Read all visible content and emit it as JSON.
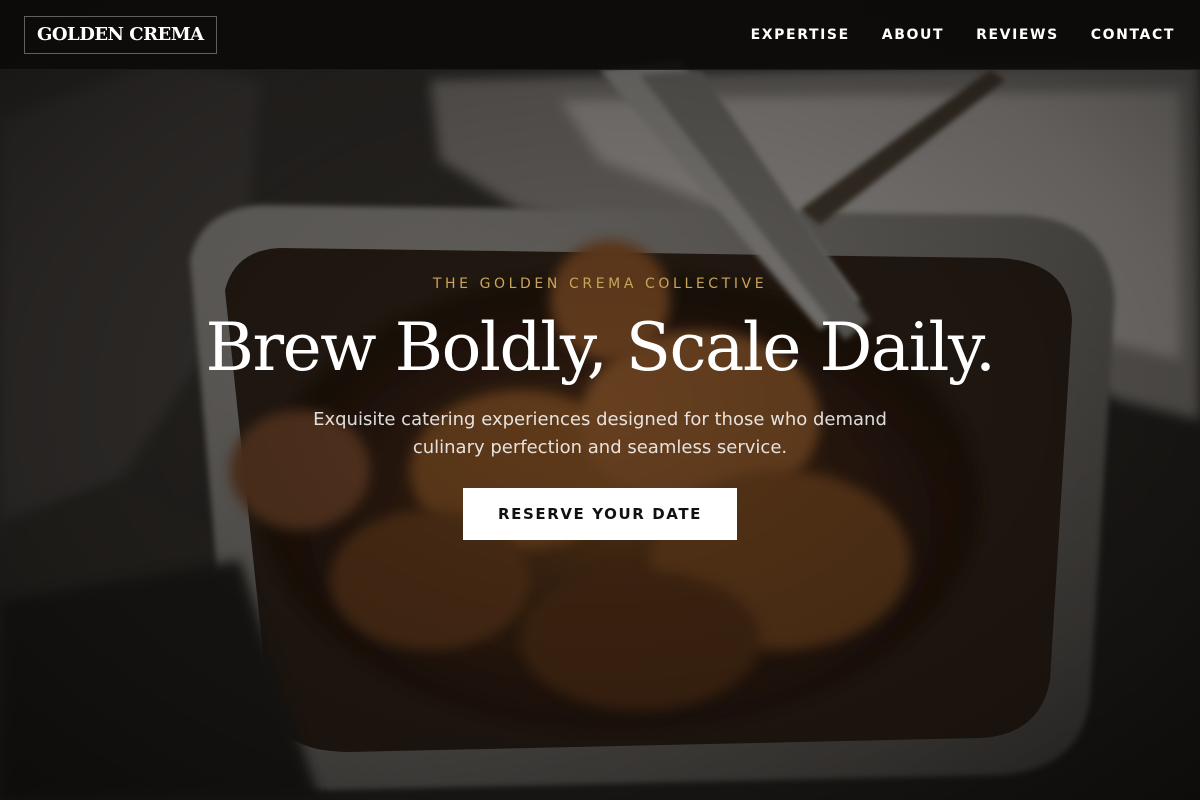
{
  "header": {
    "logo_text": "GOLDEN CREMA",
    "nav": [
      {
        "label": "EXPERTISE"
      },
      {
        "label": "ABOUT"
      },
      {
        "label": "REVIEWS"
      },
      {
        "label": "CONTACT"
      }
    ]
  },
  "hero": {
    "eyebrow": "THE GOLDEN CREMA COLLECTIVE",
    "headline": "Brew Boldly, Scale Daily.",
    "subtext": "Exquisite catering experiences designed for those who demand culinary perfection and seamless service.",
    "cta_label": "RESERVE YOUR DATE",
    "background_image": "catering-tray-food-photo"
  },
  "colors": {
    "accent_gold": "#c9a45a",
    "header_bg": "#0c0b0a",
    "cta_bg": "#ffffff",
    "cta_text": "#111111"
  }
}
